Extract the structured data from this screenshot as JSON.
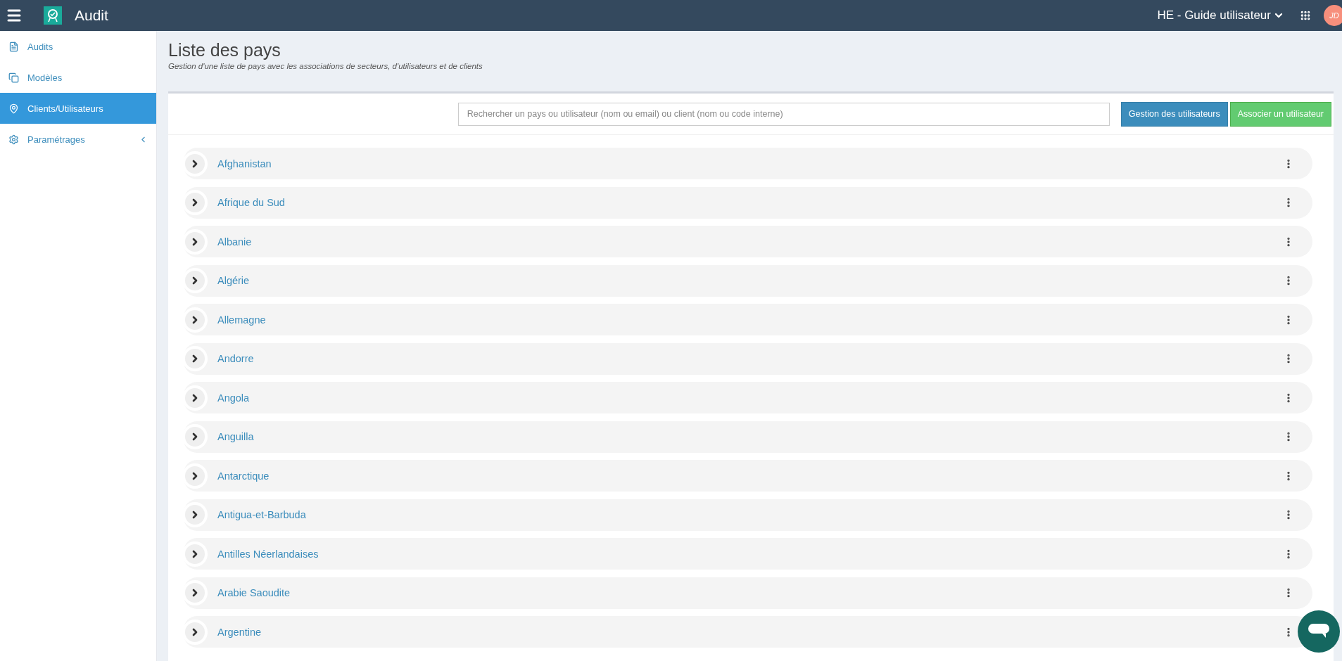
{
  "header": {
    "app_name": "Audit",
    "workspace": "HE - Guide utilisateur",
    "avatar": "JD"
  },
  "sidebar": {
    "items": [
      {
        "label": "Audits",
        "kind": "document",
        "selected": false
      },
      {
        "label": "Modèles",
        "kind": "copies",
        "selected": false
      },
      {
        "label": "Clients/Utilisateurs",
        "kind": "pin",
        "selected": true
      },
      {
        "label": "Paramétrages",
        "kind": "gears",
        "selected": false,
        "expanded": false
      }
    ]
  },
  "page": {
    "title": "Liste des pays",
    "subtitle": "Gestion d'une liste de pays avec les associations de secteurs, d'utilisateurs et de clients"
  },
  "search": {
    "placeholder": "Rechercher un pays ou utilisateur (nom ou email) ou client (nom ou code interne)"
  },
  "buttons": [
    {
      "label": "Gestion des utilisateurs",
      "kind": "primary"
    },
    {
      "label": "Associer un utilisateur",
      "kind": "success"
    }
  ],
  "countries": [
    {
      "name": "Afghanistan",
      "expanded": false
    },
    {
      "name": "Afrique du Sud",
      "expanded": false
    },
    {
      "name": "Albanie",
      "expanded": false
    },
    {
      "name": "Algérie",
      "expanded": false
    },
    {
      "name": "Allemagne",
      "expanded": false
    },
    {
      "name": "Andorre",
      "expanded": false
    },
    {
      "name": "Angola",
      "expanded": false
    },
    {
      "name": "Anguilla",
      "expanded": false
    },
    {
      "name": "Antarctique",
      "expanded": false
    },
    {
      "name": "Antigua-et-Barbuda",
      "expanded": false
    },
    {
      "name": "Antilles Néerlandaises",
      "expanded": false
    },
    {
      "name": "Arabie Saoudite",
      "expanded": false
    },
    {
      "name": "Argentine",
      "expanded": false
    }
  ]
}
